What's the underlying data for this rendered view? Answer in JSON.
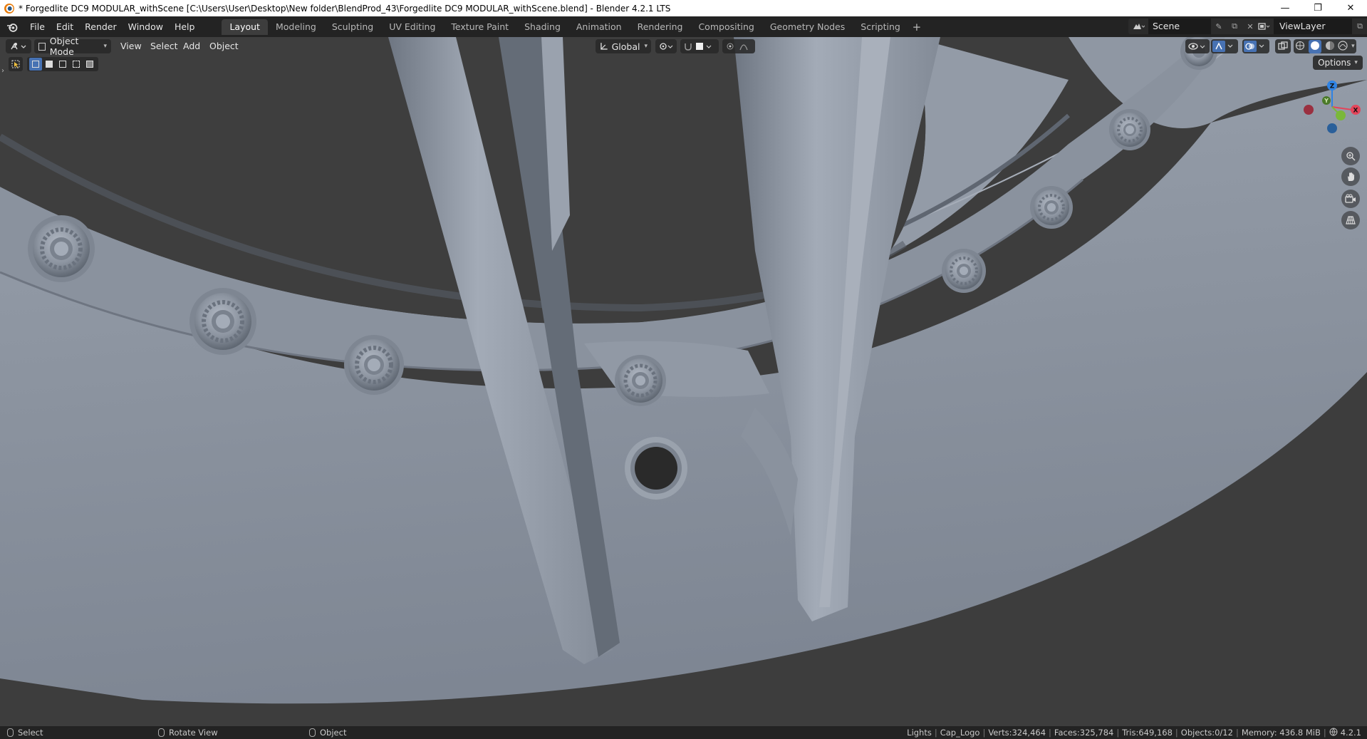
{
  "window": {
    "title": "* Forgedlite DC9 MODULAR_withScene [C:\\Users\\User\\Desktop\\New folder\\BlendProd_43\\Forgedlite DC9 MODULAR_withScene.blend] - Blender 4.2.1 LTS",
    "minimize": "—",
    "maximize": "❐",
    "close": "✕"
  },
  "menu": [
    "File",
    "Edit",
    "Render",
    "Window",
    "Help"
  ],
  "workspaces": [
    "Layout",
    "Modeling",
    "Sculpting",
    "UV Editing",
    "Texture Paint",
    "Shading",
    "Animation",
    "Rendering",
    "Compositing",
    "Geometry Nodes",
    "Scripting"
  ],
  "active_workspace": "Layout",
  "add_workspace": "+",
  "scene": {
    "name": "Scene"
  },
  "view_layer": {
    "name": "ViewLayer"
  },
  "viewport_header": {
    "mode": "Object Mode",
    "menus": [
      "View",
      "Select",
      "Add",
      "Object"
    ],
    "orientation": "Global",
    "options": "Options"
  },
  "gizmo": {
    "z": "Z",
    "y": "Y",
    "x": "X"
  },
  "statusbar": {
    "select": "Select",
    "rotate": "Rotate View",
    "object": "Object",
    "lights": "Lights",
    "collection": "Cap_Logo",
    "verts": "Verts:324,464",
    "faces": "Faces:325,784",
    "tris": "Tris:649,168",
    "objects": "Objects:0/12",
    "memory": "Memory: 436.8 MiB",
    "version": "4.2.1"
  },
  "colors": {
    "accent": "#4772b3",
    "axis_x": "#e4455a",
    "axis_y": "#7ab83a",
    "axis_z": "#2f83e4",
    "viewport_bg": "#3e3e3e",
    "mesh": "#8a929f"
  }
}
